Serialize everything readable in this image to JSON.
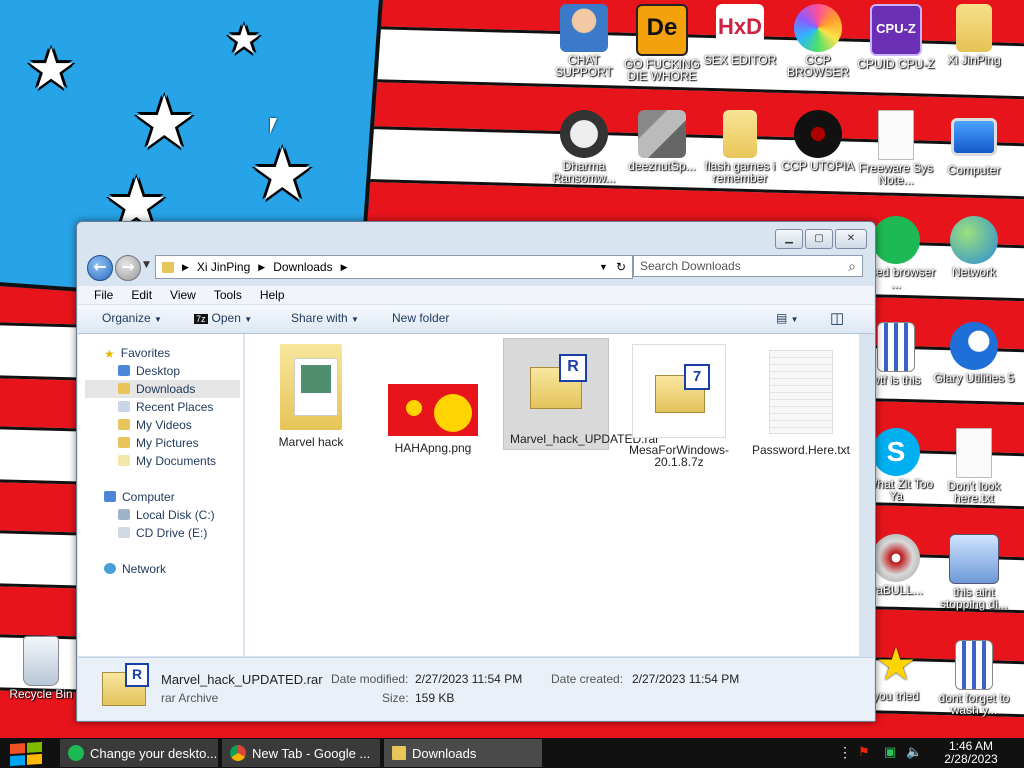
{
  "desktop": {
    "icons": [
      {
        "label": "CHAT SUPPORT",
        "icon": "support-agent-icon"
      },
      {
        "label": "GO FUCKING DIE WHORE",
        "icon": "de-app-icon"
      },
      {
        "label": "SEX EDITOR",
        "icon": "hxd-hex-editor-icon"
      },
      {
        "label": "CCP BROWSER",
        "icon": "browser-icon"
      },
      {
        "label": "CPUID CPU-Z",
        "icon": "cpuz-icon"
      },
      {
        "label": "Xi JinPing",
        "icon": "user-folder-icon"
      },
      {
        "label": "Dharma Ransomw...",
        "icon": "skull-icon"
      },
      {
        "label": "deeznutSp...",
        "icon": "stacked-windows-icon"
      },
      {
        "label": "flash games i remember",
        "icon": "folder-icon"
      },
      {
        "label": "CCP UTOPIA",
        "icon": "dark-disc-icon"
      },
      {
        "label": "Freeware Sys Note...",
        "icon": "document-icon"
      },
      {
        "label": "Computer",
        "icon": "computer-icon"
      },
      {
        "label": "based browser ...",
        "icon": "green-app-icon"
      },
      {
        "label": "Network",
        "icon": "network-icon"
      },
      {
        "label": "wtf is this",
        "icon": "grid-document-icon"
      },
      {
        "label": "Glary Utilities 5",
        "icon": "glary-icon"
      },
      {
        "label": "r What Zit Too Ya",
        "icon": "skype-icon"
      },
      {
        "label": "Don't look here.txt",
        "icon": "text-file-icon"
      },
      {
        "label": "traBULL...",
        "icon": "cd-disc-icon"
      },
      {
        "label": "this aint stopping di...",
        "icon": "installer-icon"
      },
      {
        "label": "you tried",
        "icon": "gold-star-icon"
      },
      {
        "label": "dont forget to wash y...",
        "icon": "grid-document-icon"
      },
      {
        "label": "Recycle Bin",
        "icon": "recycle-bin-icon"
      }
    ]
  },
  "explorer": {
    "breadcrumb": [
      "Xi JinPing",
      "Downloads"
    ],
    "search_placeholder": "Search Downloads",
    "menu": [
      "File",
      "Edit",
      "View",
      "Tools",
      "Help"
    ],
    "toolbar": {
      "organize": "Organize",
      "open": "Open",
      "share": "Share with",
      "new_folder": "New folder"
    },
    "nav": {
      "favorites": "Favorites",
      "favorites_items": [
        "Desktop",
        "Downloads",
        "Recent Places",
        "My Videos",
        "My Pictures",
        "My Documents"
      ],
      "computer": "Computer",
      "computer_items": [
        "Local Disk (C:)",
        "CD Drive (E:)"
      ],
      "network": "Network"
    },
    "files": [
      {
        "name": "Marvel hack",
        "icon": "folder-icon"
      },
      {
        "name": "HAHApng.png",
        "icon": "image-thumbnail-icon"
      },
      {
        "name": "Marvel_hack_UPDATED.rar",
        "icon": "winrar-archive-icon",
        "selected": true
      },
      {
        "name": "MesaForWindows-20.1.8.7z",
        "icon": "7zip-archive-icon"
      },
      {
        "name": "Password.Here.txt",
        "icon": "text-file-icon"
      }
    ],
    "details": {
      "name": "Marvel_hack_UPDATED.rar",
      "type": "rar Archive",
      "modified_label": "Date modified:",
      "modified": "2/27/2023 11:54 PM",
      "created_label": "Date created:",
      "created": "2/27/2023 11:54 PM",
      "size_label": "Size:",
      "size": "159 KB"
    }
  },
  "taskbar": {
    "tasks": [
      {
        "label": "Change your deskto...",
        "icon": "green-chat-icon"
      },
      {
        "label": "New Tab - Google ...",
        "icon": "chrome-icon"
      },
      {
        "label": "Downloads",
        "icon": "folder-icon"
      }
    ],
    "time": "1:46 AM",
    "date": "2/28/2023"
  },
  "colors": {
    "flag_red": "#e8141b",
    "flag_blue": "#27a3e8",
    "accent": "#2f6fc0",
    "selection": "#d9d9d9"
  }
}
